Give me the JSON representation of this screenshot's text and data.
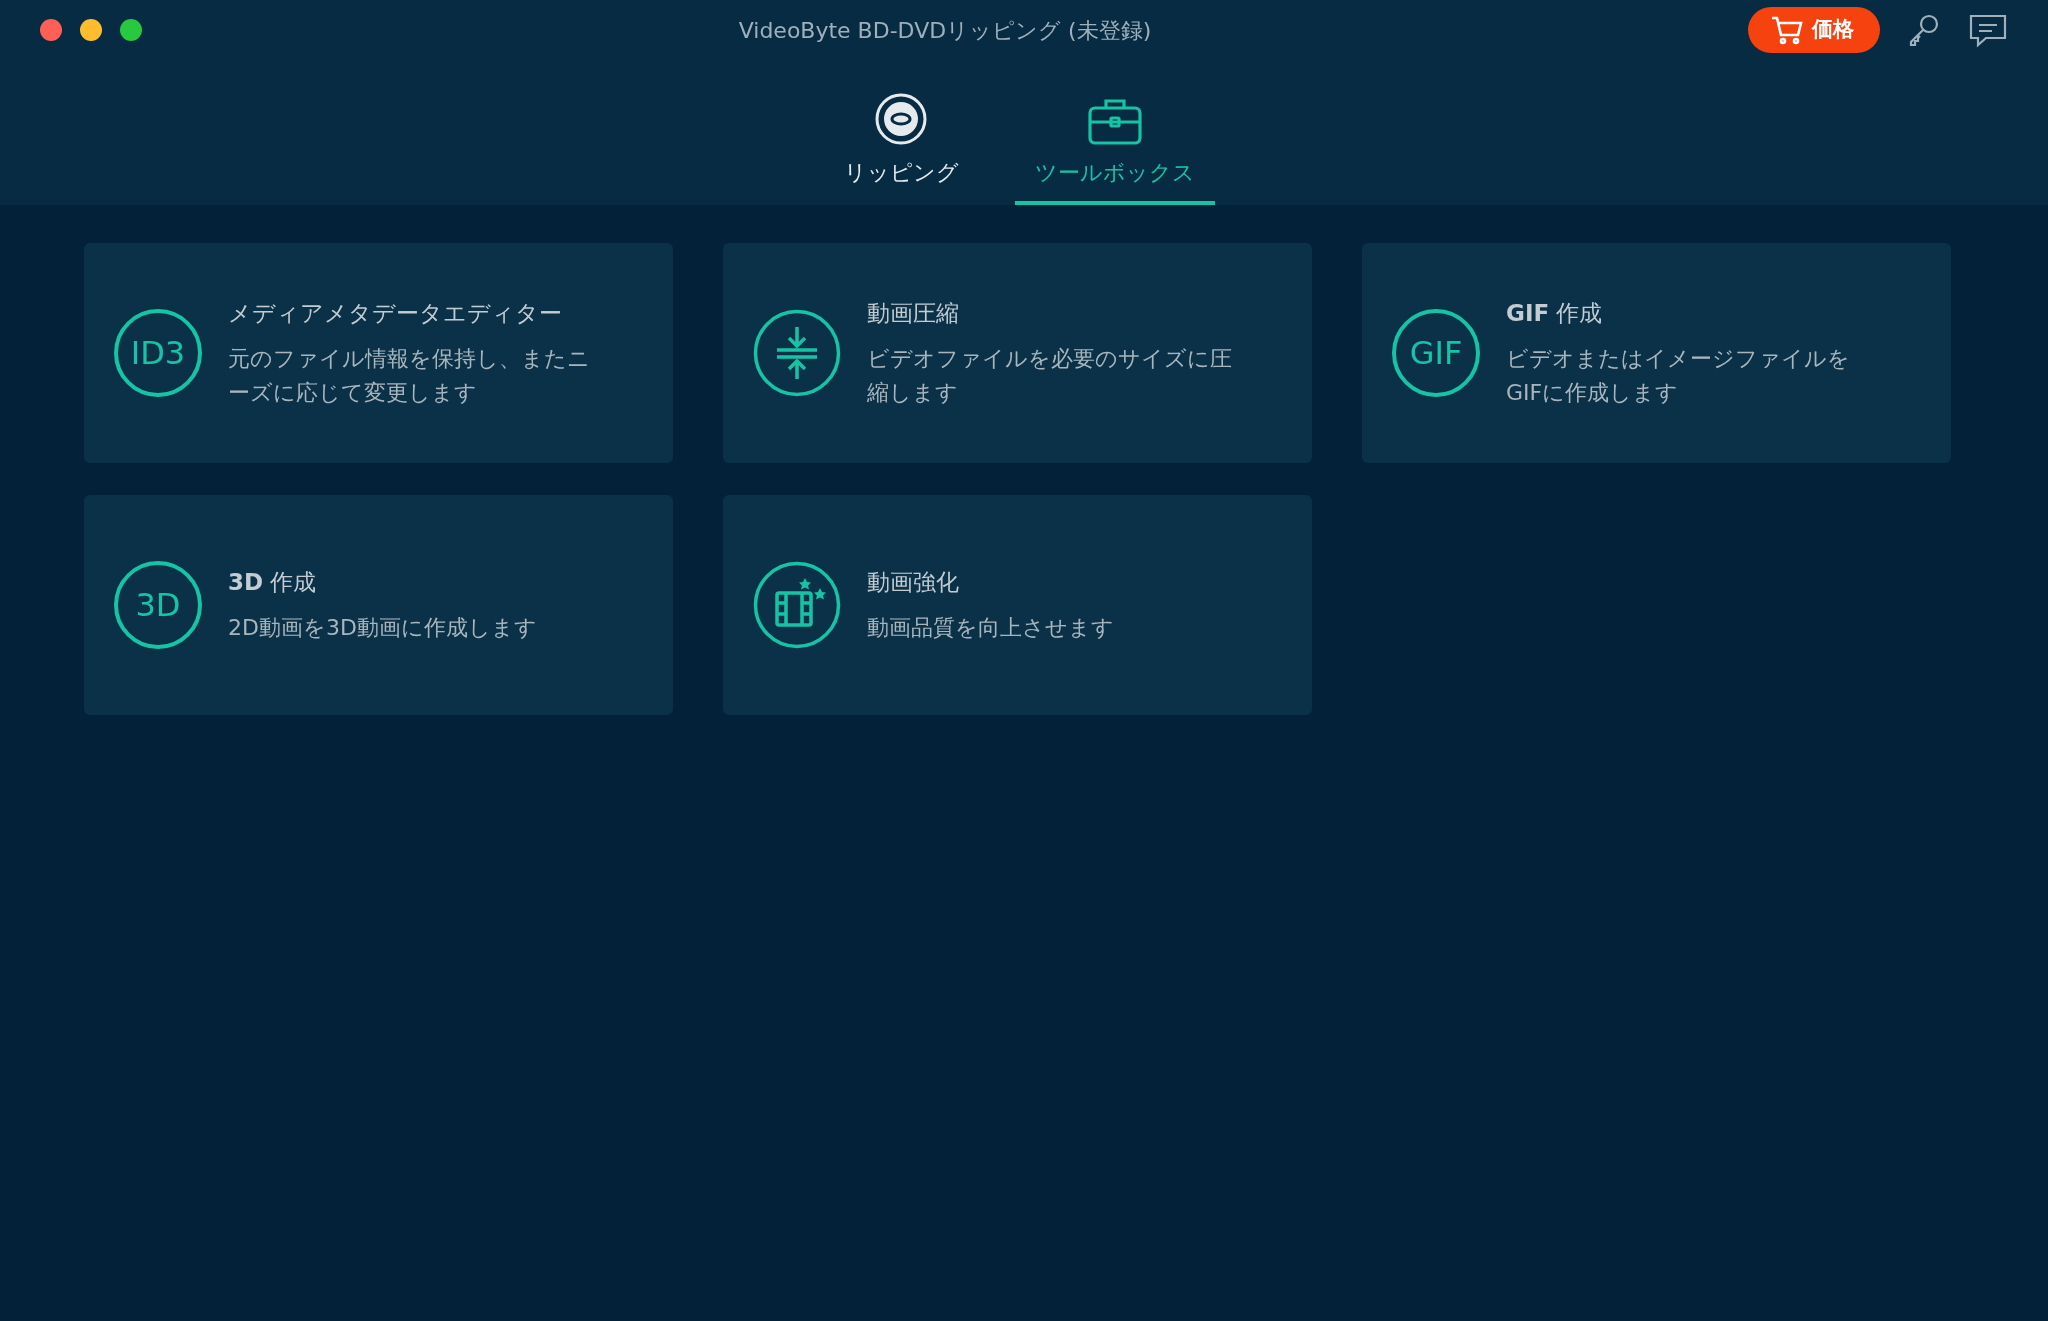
{
  "window": {
    "title": "VideoByte BD-DVDリッピング (未登録)",
    "price_button": "価格"
  },
  "tabs": [
    {
      "label": "リッピング",
      "kind": "disc",
      "selected": false
    },
    {
      "label": "ツールボックス",
      "kind": "toolbox",
      "selected": true
    }
  ],
  "tools": [
    {
      "kind": "text",
      "icon_text": "ID3",
      "title": "メディアメタデータエディター",
      "description": "元のファイル情報を保持し、またニーズに応じて変更します"
    },
    {
      "kind": "compress",
      "title": "動画圧縮",
      "description": "ビデオファイルを必要のサイズに圧縮します"
    },
    {
      "kind": "text",
      "icon_text": "GIF",
      "title": "**GIF** 作成",
      "description": "ビデオまたはイメージファイルをGIFに作成します"
    },
    {
      "kind": "text",
      "icon_text": "3D",
      "title": "**3D** 作成",
      "description": "2D動画を3D動画に作成します"
    },
    {
      "kind": "enhance",
      "title": "動画強化",
      "description": "動画品質を向上させます"
    }
  ]
}
